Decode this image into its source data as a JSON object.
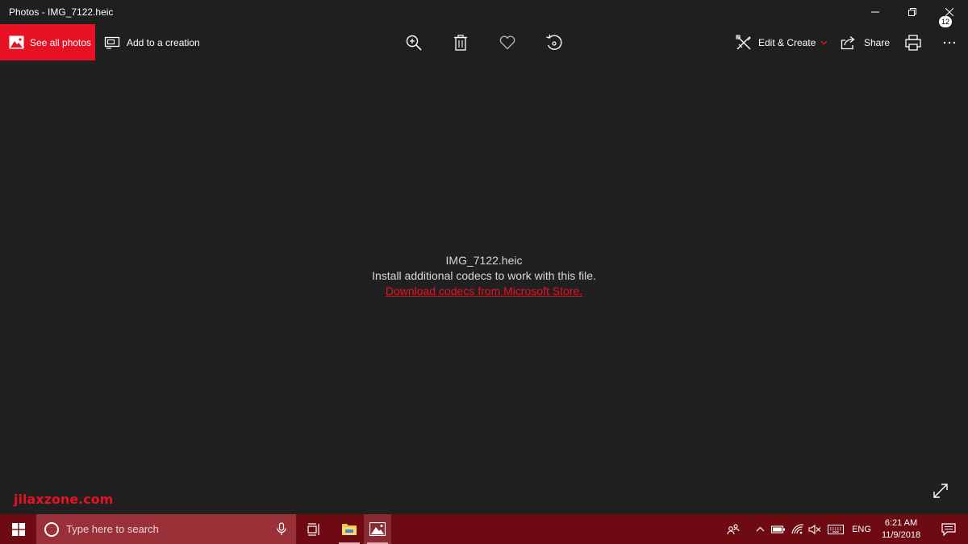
{
  "window": {
    "title": "Photos - IMG_7122.heic"
  },
  "toolbar": {
    "see_all_photos": "See all photos",
    "add_to_creation": "Add to a creation",
    "edit_create": "Edit & Create",
    "share": "Share",
    "icons": [
      "zoom-icon",
      "delete-icon",
      "heart-icon",
      "rotate-icon",
      "print-icon",
      "more-icon"
    ]
  },
  "message": {
    "filename": "IMG_7122.heic",
    "info": "Install additional codecs to work with this file.",
    "link": "Download codecs from Microsoft Store."
  },
  "watermark": "jilaxzone.com",
  "taskbar": {
    "search_placeholder": "Type here to search",
    "language": "ENG",
    "time": "6:21 AM",
    "date": "11/9/2018",
    "notification_count": "12"
  },
  "colors": {
    "accent": "#e81123",
    "background": "#202020",
    "taskbar": "#6d0a12"
  }
}
